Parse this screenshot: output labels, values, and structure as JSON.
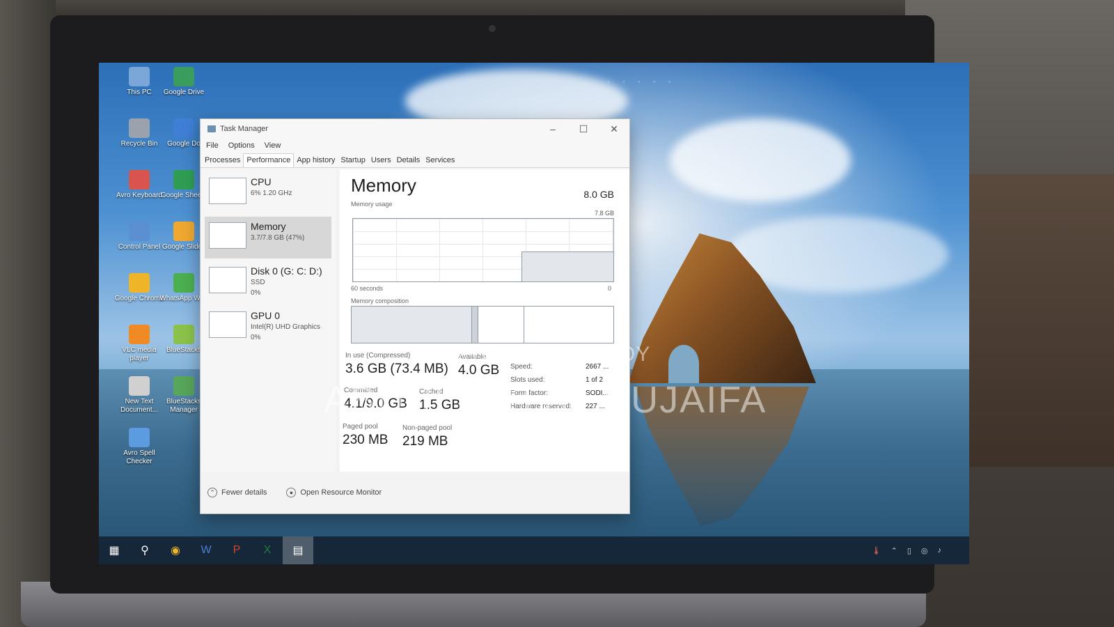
{
  "desktop": {
    "icons": [
      {
        "label": "This PC",
        "icon": "computer-icon"
      },
      {
        "label": "Google Drive",
        "icon": "drive-icon"
      },
      {
        "label": "Recycle Bin",
        "icon": "recycle-bin-icon"
      },
      {
        "label": "Google Do",
        "icon": "docs-icon"
      },
      {
        "label": "Avro Keyboard",
        "icon": "keyboard-icon"
      },
      {
        "label": "Google Sheets",
        "icon": "sheets-icon"
      },
      {
        "label": "Control Panel",
        "icon": "control-panel-icon"
      },
      {
        "label": "Google Slides",
        "icon": "slides-icon"
      },
      {
        "label": "Google Chrome",
        "icon": "chrome-icon"
      },
      {
        "label": "WhatsApp Web",
        "icon": "whatsapp-icon"
      },
      {
        "label": "VLC media player",
        "icon": "vlc-icon"
      },
      {
        "label": "BlueStacks",
        "icon": "bluestacks-icon"
      },
      {
        "label": "New Text Document...",
        "icon": "text-document-icon"
      },
      {
        "label": "BlueStacks Manager",
        "icon": "bluestacks-icon"
      },
      {
        "label": "Avro Spell Checker",
        "icon": "spell-checker-icon"
      }
    ]
  },
  "window": {
    "title": "Task Manager",
    "menu": [
      "File",
      "Options",
      "View"
    ],
    "tabs": [
      "Processes",
      "Performance",
      "App history",
      "Startup",
      "Users",
      "Details",
      "Services"
    ],
    "active_tab": "Performance"
  },
  "sidebar": {
    "items": [
      {
        "name": "CPU",
        "sub1": "6%  1.20 GHz",
        "sub2": "",
        "sub3": ""
      },
      {
        "name": "Memory",
        "sub1": "3.7/7.8 GB (47%)",
        "sub2": "",
        "sub3": ""
      },
      {
        "name": "Disk 0 (G: C: D:)",
        "sub1": "SSD",
        "sub2": "0%",
        "sub3": ""
      },
      {
        "name": "GPU 0",
        "sub1": "Intel(R) UHD Graphics",
        "sub2": "0%",
        "sub3": ""
      }
    ],
    "active_index": 1
  },
  "memory": {
    "title": "Memory",
    "total": "8.0 GB",
    "usage_label": "Memory usage",
    "usage_max": "7.8 GB",
    "axis_left": "60 seconds",
    "axis_right": "0",
    "composition_label": "Memory composition",
    "usage_fraction": 0.47,
    "stats": {
      "in_use_label": "In use (Compressed)",
      "in_use_value": "3.6 GB (73.4 MB)",
      "available_label": "Available",
      "available_value": "4.0 GB",
      "committed_label": "Committed",
      "committed_value": "4.1/9.0 GB",
      "cached_label": "Cached",
      "cached_value": "1.5 GB",
      "paged_label": "Paged pool",
      "paged_value": "230 MB",
      "nonpaged_label": "Non-paged pool",
      "nonpaged_value": "219 MB"
    },
    "details": [
      {
        "k": "Speed:",
        "v": "2667 ..."
      },
      {
        "k": "Slots used:",
        "v": "1 of 2"
      },
      {
        "k": "Form factor:",
        "v": "SODI..."
      },
      {
        "k": "Hardware reserved:",
        "v": "227 ..."
      }
    ]
  },
  "footer": {
    "fewer_details": "Fewer details",
    "open_resource_monitor": "Open Resource Monitor"
  },
  "watermark": {
    "line1": "POSTED ON BIKROY",
    "line2": "ABDULLAH AL HUJAIFA"
  },
  "colors": {
    "accent": "#8e9aa8",
    "window_bg": "#f3f3f3",
    "selected_item": "#d7d7d7"
  }
}
